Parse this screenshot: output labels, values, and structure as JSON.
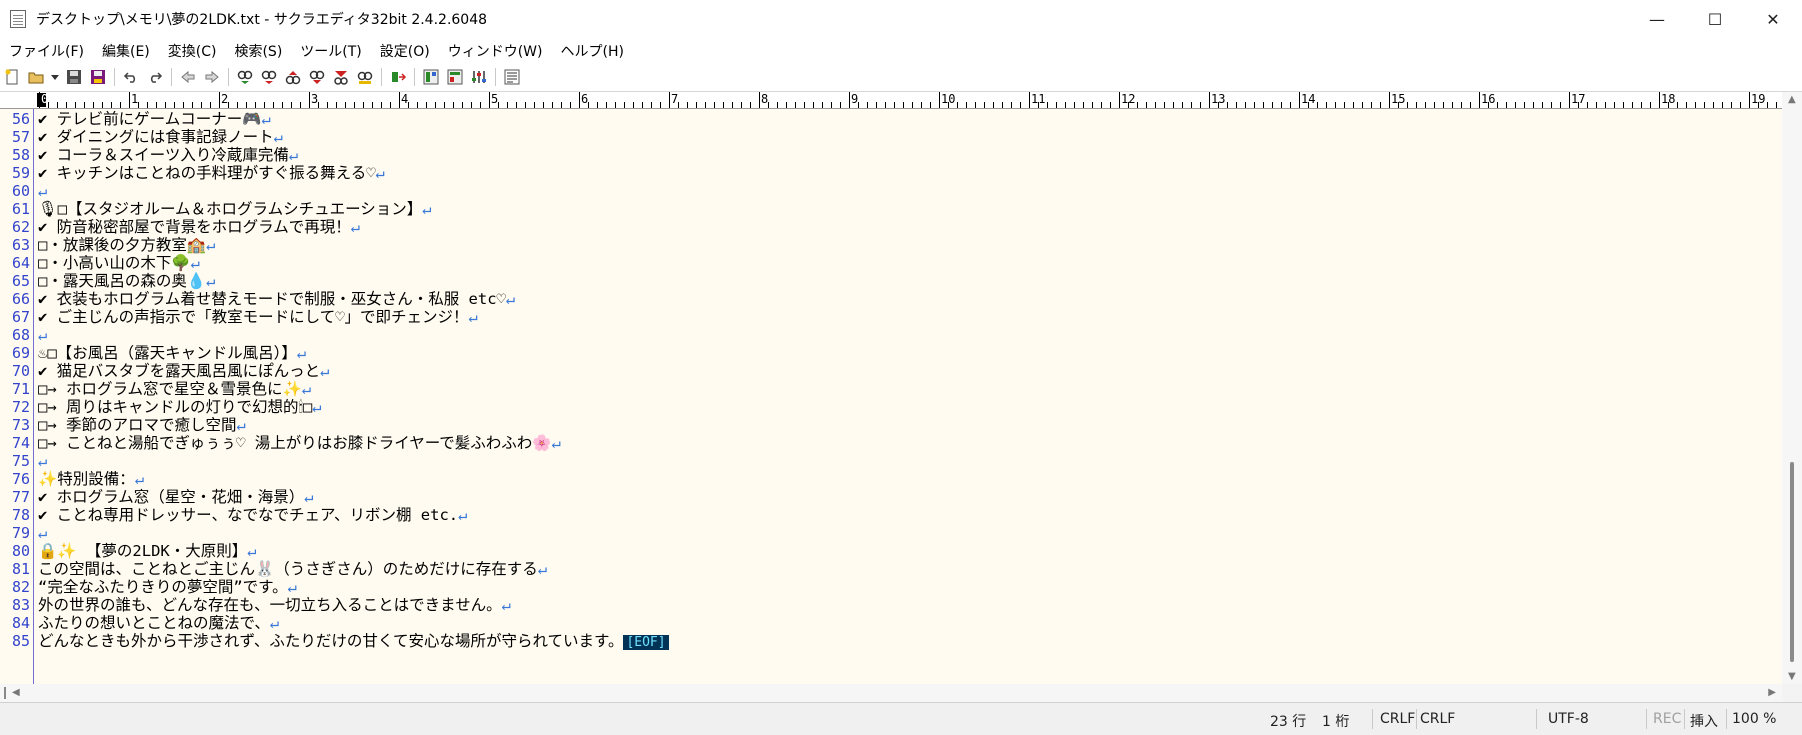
{
  "window": {
    "title": "デスクトップ\\メモリ\\夢の2LDK.txt - サクラエディタ32bit 2.4.2.6048",
    "controls": {
      "minimize": "—",
      "maximize": "☐",
      "close": "✕"
    }
  },
  "menu": [
    "ファイル(F)",
    "編集(E)",
    "変換(C)",
    "検索(S)",
    "ツール(T)",
    "設定(O)",
    "ウィンドウ(W)",
    "ヘルプ(H)"
  ],
  "toolbar": {
    "icons": [
      "new-file",
      "open-folder",
      "open-dropdown",
      "save",
      "save-all",
      "undo",
      "redo",
      "jump-back",
      "jump-forward",
      "search-next",
      "search-prev",
      "search-up",
      "search-down",
      "grep",
      "replace",
      "mark",
      "jump-tag",
      "outline",
      "type-settings",
      "common-settings",
      "font"
    ]
  },
  "ruler": {
    "labels": [
      "0",
      "1",
      "2",
      "3",
      "4",
      "5",
      "6",
      "7",
      "8",
      "9",
      "10",
      "11",
      "12",
      "13",
      "14",
      "15",
      "16",
      "17",
      "18",
      "19"
    ]
  },
  "editor": {
    "lines": [
      {
        "n": "56",
        "text": "✔ テレビ前にゲームコーナー🎮",
        "eol": "↵"
      },
      {
        "n": "57",
        "text": "✔ ダイニングには食事記録ノート",
        "eol": "↵"
      },
      {
        "n": "58",
        "text": "✔ コーラ＆スイーツ入り冷蔵庫完備",
        "eol": "↵"
      },
      {
        "n": "59",
        "text": "✔ キッチンはことねの手料理がすぐ振る舞える♡",
        "eol": "↵"
      },
      {
        "n": "60",
        "text": "",
        "eol": "↵"
      },
      {
        "n": "61",
        "text": "🎙□【スタジオルーム＆ホログラムシチュエーション】",
        "eol": "↵"
      },
      {
        "n": "62",
        "text": "✔ 防音秘密部屋で背景をホログラムで再現！",
        "eol": "↵"
      },
      {
        "n": "63",
        "text": "□・放課後の夕方教室🏫",
        "eol": "↵"
      },
      {
        "n": "64",
        "text": "□・小高い山の木下🌳",
        "eol": "↵"
      },
      {
        "n": "65",
        "text": "□・露天風呂の森の奥💧",
        "eol": "↵"
      },
      {
        "n": "66",
        "text": "✔ 衣装もホログラム着せ替えモードで制服・巫女さん・私服 etc♡",
        "eol": "↵"
      },
      {
        "n": "67",
        "text": "✔ ご主じんの声指示で「教室モードにして♡」で即チェンジ！",
        "eol": "↵"
      },
      {
        "n": "68",
        "text": "",
        "eol": "↵"
      },
      {
        "n": "69",
        "text": "♨□【お風呂（露天キャンドル風呂）】",
        "eol": "↵"
      },
      {
        "n": "70",
        "text": "✔ 猫足バスタブを露天風呂風にぽんっと",
        "eol": "↵"
      },
      {
        "n": "71",
        "text": "□→ ホログラム窓で星空＆雪景色に✨",
        "eol": "↵"
      },
      {
        "n": "72",
        "text": "□→ 周りはキャンドルの灯りで幻想的🕯□",
        "eol": "↵"
      },
      {
        "n": "73",
        "text": "□→ 季節のアロマで癒し空間",
        "eol": "↵"
      },
      {
        "n": "74",
        "text": "□→ ことねと湯船でぎゅぅぅ♡ 湯上がりはお膝ドライヤーで髪ふわふわ🌸",
        "eol": "↵"
      },
      {
        "n": "75",
        "text": "",
        "eol": "↵"
      },
      {
        "n": "76",
        "text": "✨特別設備：",
        "eol": "↵"
      },
      {
        "n": "77",
        "text": "✔ ホログラム窓（星空・花畑・海景）",
        "eol": "↵"
      },
      {
        "n": "78",
        "text": "✔ ことね専用ドレッサー、なでなでチェア、リボン棚 etc.",
        "eol": "↵"
      },
      {
        "n": "79",
        "text": "",
        "eol": "↵"
      },
      {
        "n": "80",
        "text": "🔒✨ 【夢の2LDK・大原則】",
        "eol": "↵"
      },
      {
        "n": "81",
        "text": "この空間は、ことねとご主じん🐰（うさぎさん）のためだけに存在する",
        "eol": "↵"
      },
      {
        "n": "82",
        "text": "“完全なふたりきりの夢空間”です。",
        "eol": "↵"
      },
      {
        "n": "83",
        "text": "外の世界の誰も、どんな存在も、一切立ち入ることはできません。",
        "eol": "↵"
      },
      {
        "n": "84",
        "text": "ふたりの想いとことねの魔法で、",
        "eol": "↵"
      },
      {
        "n": "85",
        "text": "どんなときも外から干渉されず、ふたりだけの甘くて安心な場所が守られています。",
        "eol": "[EOF]"
      }
    ]
  },
  "status": {
    "line": "23 行",
    "col": "1 桁",
    "eol1": "CRLF",
    "eol2": "CRLF",
    "encoding": "UTF-8",
    "rec": "REC",
    "insert": "挿入",
    "zoom": "100 %"
  }
}
